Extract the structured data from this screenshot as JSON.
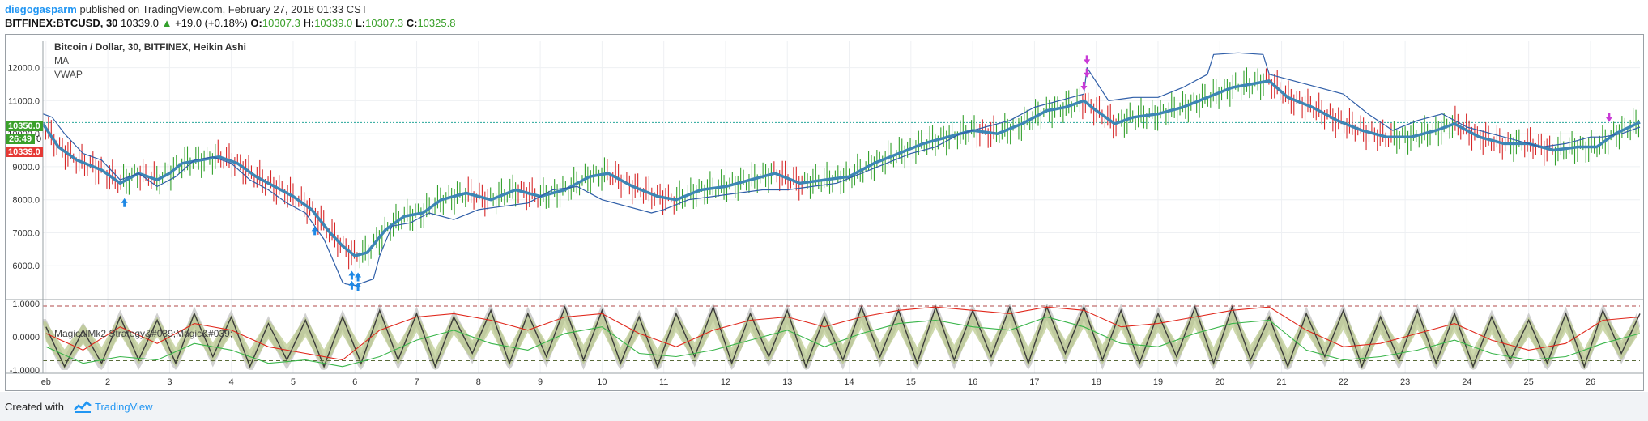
{
  "header": {
    "author": "diegogasparm",
    "published_text": "published on TradingView.com, February 27, 2018 01:33 CST",
    "symbol": "BITFINEX:BTCUSD, 30",
    "last": "10339.0",
    "change": "+19.0 (+0.18%)",
    "open_label": "O:",
    "open": "10307.3",
    "high_label": "H:",
    "high": "10339.0",
    "low_label": "L:",
    "low": "10307.3",
    "close_label": "C:",
    "close": "10325.8"
  },
  "legend": {
    "title": "Bitcoin / Dollar, 30, BITFINEX, Heikin Ashi",
    "ma": "MA",
    "vwap": "VWAP",
    "indicator": "MagicalMk2 Strategy&#039;Magic&#039;"
  },
  "price_tags": {
    "upper": "10350.0",
    "timer": "26:49",
    "lower": "10339.0",
    "zero": "0"
  },
  "footer": {
    "created_with": "Created with",
    "brand": "TradingView"
  },
  "colors": {
    "ma": "#3d86b5",
    "vwap": "#2f5ea8",
    "candle_up": "#33a02c",
    "candle_down": "#d62728",
    "buy_arrow": "#1e88e5",
    "sell_arrow": "#c93ad6",
    "osc_black": "#3a3a3a",
    "osc_red": "#e0271b",
    "osc_green": "#39b54a",
    "band_gray": "#bdbdbd",
    "band_olive": "#b9c98a"
  },
  "chart_data": [
    {
      "type": "line",
      "title": "Bitcoin / Dollar, 30, BITFINEX, Heikin Ashi",
      "x_ticks": [
        "eb",
        "2",
        "3",
        "4",
        "5",
        "6",
        "7",
        "8",
        "9",
        "10",
        "11",
        "12",
        "13",
        "14",
        "15",
        "16",
        "17",
        "18",
        "19",
        "20",
        "21",
        "22",
        "23",
        "24",
        "25",
        "26"
      ],
      "x_tick_days": [
        1,
        2,
        3,
        4,
        5,
        6,
        7,
        8,
        9,
        10,
        11,
        12,
        13,
        14,
        15,
        16,
        17,
        18,
        19,
        20,
        21,
        22,
        23,
        24,
        25,
        26
      ],
      "y_ticks": [
        "12000.0",
        "11000.0",
        "10000.0",
        "9000.0",
        "8000.0",
        "7000.0",
        "6000.0"
      ],
      "y_tick_values": [
        12000,
        11000,
        10000,
        9000,
        8000,
        7000,
        6000
      ],
      "ylim": [
        5000,
        12800
      ],
      "xlim": [
        0.95,
        26.8
      ],
      "last_price_line": 10339,
      "series": [
        {
          "name": "MA",
          "x": [
            0.95,
            1.2,
            1.5,
            1.9,
            2.2,
            2.5,
            2.8,
            3.0,
            3.2,
            3.5,
            3.8,
            4.1,
            4.4,
            4.7,
            5.0,
            5.3,
            5.6,
            5.8,
            6.0,
            6.2,
            6.5,
            6.8,
            7.1,
            7.4,
            7.8,
            8.2,
            8.6,
            9.0,
            9.4,
            9.8,
            10.1,
            10.5,
            10.9,
            11.2,
            11.6,
            12.0,
            12.4,
            12.8,
            13.2,
            13.6,
            14.0,
            14.4,
            14.8,
            15.2,
            15.6,
            16.0,
            16.4,
            16.8,
            17.2,
            17.5,
            17.8,
            18.0,
            18.3,
            18.6,
            19.0,
            19.4,
            19.8,
            20.2,
            20.5,
            20.8,
            21.1,
            21.5,
            21.9,
            22.3,
            22.7,
            23.1,
            23.5,
            23.8,
            24.2,
            24.6,
            25.0,
            25.4,
            25.8,
            26.1,
            26.4,
            26.8
          ],
          "y": [
            10300,
            9600,
            9200,
            8900,
            8500,
            8800,
            8600,
            8800,
            9100,
            9200,
            9300,
            9100,
            8700,
            8400,
            8100,
            7700,
            7000,
            6600,
            6300,
            6400,
            7100,
            7500,
            7600,
            8000,
            8200,
            8000,
            8300,
            8100,
            8300,
            8700,
            8800,
            8400,
            8100,
            8000,
            8300,
            8400,
            8600,
            8800,
            8500,
            8600,
            8700,
            9100,
            9400,
            9700,
            9900,
            10100,
            10000,
            10300,
            10700,
            10800,
            11000,
            10700,
            10300,
            10500,
            10600,
            10800,
            11100,
            11400,
            11500,
            11600,
            11100,
            10800,
            10400,
            10100,
            9900,
            9900,
            10100,
            10300,
            9900,
            9700,
            9700,
            9500,
            9600,
            9600,
            10000,
            10350
          ]
        },
        {
          "name": "VWAP",
          "x": [
            0.95,
            1.1,
            1.3,
            1.6,
            1.9,
            2.2,
            2.5,
            2.8,
            3.1,
            3.4,
            3.7,
            4.0,
            4.3,
            4.6,
            4.9,
            5.2,
            5.5,
            5.8,
            5.85,
            6.0,
            6.3,
            6.4,
            6.6,
            6.9,
            7.2,
            7.6,
            8.0,
            8.4,
            8.8,
            9.2,
            9.6,
            10.0,
            10.4,
            10.8,
            11.0,
            11.4,
            11.8,
            12.2,
            12.6,
            13.0,
            13.4,
            13.8,
            14.2,
            14.6,
            15.0,
            15.4,
            15.8,
            16.2,
            16.6,
            17.0,
            17.4,
            17.8,
            17.85,
            18.2,
            18.6,
            19.0,
            19.4,
            19.8,
            19.9,
            20.3,
            20.7,
            20.8,
            21.2,
            21.6,
            22.0,
            22.4,
            22.8,
            23.2,
            23.6,
            24.0,
            24.4,
            24.8,
            25.2,
            25.6,
            26.0,
            26.2,
            26.5,
            26.8
          ],
          "y": [
            10600,
            10500,
            10000,
            9400,
            9200,
            8600,
            8800,
            8400,
            8700,
            9200,
            9300,
            9100,
            8600,
            8300,
            7900,
            7600,
            6800,
            5500,
            5450,
            5400,
            5600,
            6300,
            7200,
            7300,
            7600,
            7400,
            7700,
            7800,
            7900,
            8300,
            8400,
            8000,
            7800,
            7600,
            7700,
            8000,
            8100,
            8200,
            8300,
            8300,
            8400,
            8500,
            8800,
            9100,
            9400,
            9600,
            10000,
            10200,
            10400,
            10800,
            11000,
            11200,
            12000,
            11000,
            11100,
            11100,
            11400,
            11800,
            12400,
            12450,
            12400,
            11800,
            11600,
            11400,
            11200,
            10600,
            10100,
            10400,
            10600,
            10200,
            10000,
            9800,
            9600,
            9700,
            9900,
            9900,
            10000,
            10200
          ]
        }
      ],
      "buy_signals": [
        {
          "x": 2.27,
          "y": 7900
        },
        {
          "x": 5.35,
          "y": 7050
        },
        {
          "x": 5.95,
          "y": 5700
        },
        {
          "x": 6.05,
          "y": 5650
        },
        {
          "x": 5.95,
          "y": 5400
        },
        {
          "x": 6.05,
          "y": 5350
        }
      ],
      "sell_signals": [
        {
          "x": 17.8,
          "y": 11450
        },
        {
          "x": 17.85,
          "y": 11850
        },
        {
          "x": 17.85,
          "y": 12250
        },
        {
          "x": 26.3,
          "y": 10500
        }
      ]
    },
    {
      "type": "line",
      "title": "MagicalMk2 Strategy&#039;Magic&#039;",
      "y_ticks": [
        "1.0000",
        "0.0000",
        "-1.0000"
      ],
      "y_tick_values": [
        1,
        0,
        -1
      ],
      "ylim": [
        -1.1,
        1.1
      ],
      "hlines": [
        0.93,
        -0.72
      ],
      "series": [
        {
          "name": "",
          "x": [
            1.0,
            1.3,
            1.6,
            1.9,
            2.2,
            2.5,
            2.8,
            3.1,
            3.4,
            3.7,
            4.0,
            4.3,
            4.6,
            4.9,
            5.2,
            5.5,
            5.8,
            6.1,
            6.4,
            6.7,
            7.0,
            7.3,
            7.6,
            7.9,
            8.2,
            8.5,
            8.8,
            9.1,
            9.4,
            9.7,
            10.0,
            10.3,
            10.6,
            10.9,
            11.2,
            11.5,
            11.8,
            12.1,
            12.4,
            12.7,
            13.0,
            13.3,
            13.6,
            13.9,
            14.2,
            14.5,
            14.8,
            15.1,
            15.4,
            15.7,
            16.0,
            16.3,
            16.6,
            16.9,
            17.2,
            17.5,
            17.8,
            18.1,
            18.4,
            18.7,
            19.0,
            19.3,
            19.6,
            19.9,
            20.2,
            20.5,
            20.8,
            21.1,
            21.4,
            21.7,
            22.0,
            22.3,
            22.6,
            22.9,
            23.2,
            23.5,
            23.8,
            24.1,
            24.4,
            24.7,
            25.0,
            25.3,
            25.6,
            25.9,
            26.2,
            26.5,
            26.8
          ],
          "y": [
            0.3,
            -0.9,
            0.2,
            -0.8,
            0.6,
            -0.7,
            0.5,
            -0.8,
            0.7,
            -0.6,
            0.6,
            -0.9,
            0.4,
            -0.7,
            0.5,
            -0.9,
            0.6,
            -0.8,
            0.8,
            -0.7,
            0.7,
            -0.9,
            0.6,
            -0.5,
            0.8,
            -0.8,
            0.7,
            -0.6,
            0.9,
            -0.7,
            0.8,
            -0.8,
            0.6,
            -0.9,
            0.7,
            -0.6,
            0.9,
            -0.8,
            0.7,
            -0.6,
            0.8,
            -0.9,
            0.6,
            -0.7,
            0.9,
            -0.6,
            0.8,
            -0.8,
            0.9,
            -0.7,
            0.8,
            -0.6,
            0.9,
            -0.8,
            0.9,
            -0.5,
            0.9,
            -0.7,
            0.8,
            -0.8,
            0.7,
            -0.6,
            0.9,
            -0.8,
            0.9,
            -0.7,
            0.6,
            -0.9,
            0.7,
            -0.6,
            0.8,
            -0.9,
            0.6,
            -0.7,
            0.8,
            -0.8,
            0.7,
            -0.9,
            0.6,
            -0.7,
            0.5,
            -0.8,
            0.7,
            -0.9,
            0.8,
            -0.5,
            0.7
          ]
        },
        {
          "name": "",
          "x": [
            1.0,
            1.6,
            2.2,
            2.8,
            3.4,
            4.0,
            4.6,
            5.2,
            5.8,
            6.4,
            7.0,
            7.6,
            8.2,
            8.8,
            9.4,
            10.0,
            10.6,
            11.2,
            11.8,
            12.4,
            13.0,
            13.6,
            14.2,
            14.8,
            15.4,
            16.0,
            16.6,
            17.2,
            17.8,
            18.4,
            19.0,
            19.6,
            20.2,
            20.8,
            21.4,
            22.0,
            22.6,
            23.2,
            23.8,
            24.4,
            25.0,
            25.6,
            26.2,
            26.8
          ],
          "y": [
            0.1,
            -0.4,
            0.3,
            -0.2,
            0.4,
            0.2,
            -0.3,
            -0.5,
            -0.7,
            0.2,
            0.6,
            0.7,
            0.5,
            0.2,
            0.6,
            0.7,
            0.1,
            -0.3,
            0.2,
            0.5,
            0.6,
            0.3,
            0.6,
            0.8,
            0.9,
            0.8,
            0.7,
            0.9,
            0.8,
            0.3,
            0.4,
            0.6,
            0.8,
            0.9,
            0.2,
            -0.3,
            -0.2,
            0.1,
            0.4,
            -0.1,
            -0.4,
            -0.2,
            0.5,
            0.6
          ]
        },
        {
          "name": "",
          "x": [
            1.0,
            1.6,
            2.2,
            2.8,
            3.4,
            4.0,
            4.6,
            5.2,
            5.8,
            6.4,
            7.0,
            7.6,
            8.2,
            8.8,
            9.4,
            10.0,
            10.6,
            11.2,
            11.8,
            12.4,
            13.0,
            13.6,
            14.2,
            14.8,
            15.4,
            16.0,
            16.6,
            17.2,
            17.8,
            18.4,
            19.0,
            19.6,
            20.2,
            20.8,
            21.4,
            22.0,
            22.6,
            23.2,
            23.8,
            24.4,
            25.0,
            25.6,
            26.2,
            26.8
          ],
          "y": [
            -0.3,
            -0.8,
            -0.6,
            -0.7,
            -0.2,
            -0.4,
            -0.8,
            -0.7,
            -0.9,
            -0.6,
            -0.1,
            0.2,
            -0.2,
            -0.4,
            0.1,
            0.3,
            -0.5,
            -0.6,
            -0.4,
            -0.1,
            0.2,
            -0.3,
            0.1,
            0.4,
            0.5,
            0.3,
            0.2,
            0.6,
            0.3,
            -0.2,
            -0.3,
            0.1,
            0.4,
            0.5,
            -0.4,
            -0.7,
            -0.6,
            -0.4,
            -0.1,
            -0.5,
            -0.7,
            -0.6,
            -0.2,
            0.1
          ]
        }
      ]
    }
  ]
}
